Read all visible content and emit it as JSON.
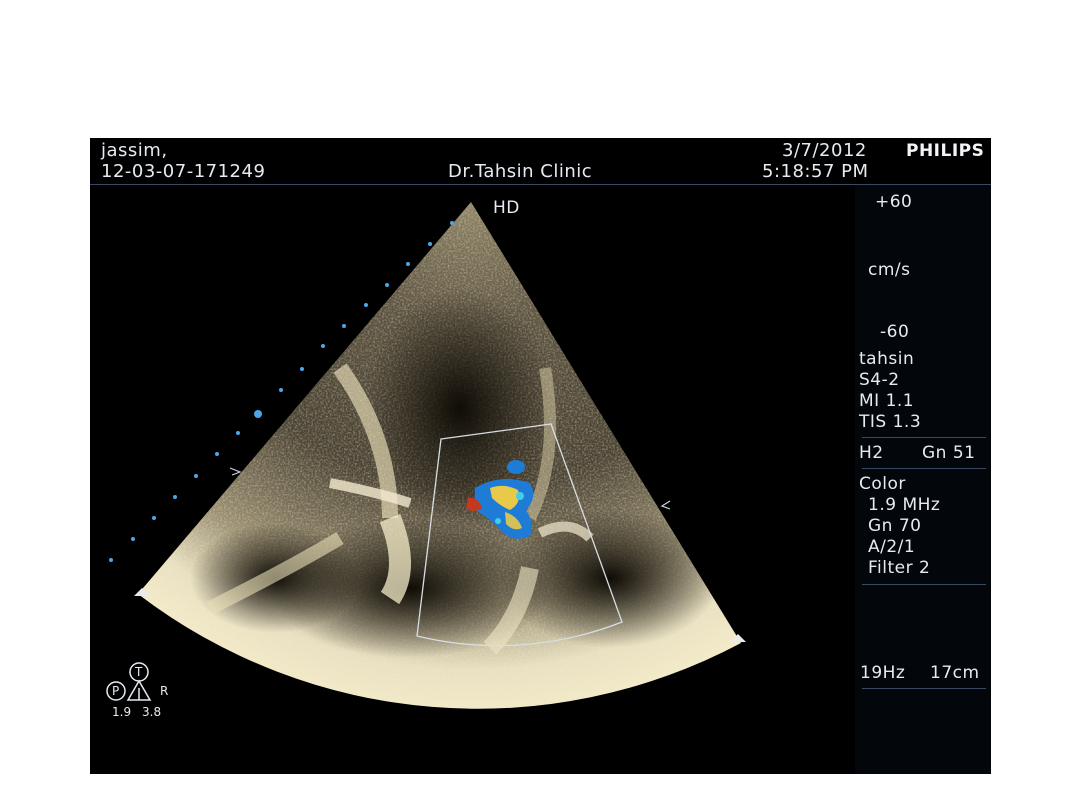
{
  "header": {
    "patient_name": "jassim,",
    "patient_id": "12-03-07-171249",
    "clinic": "Dr.Tahsin Clinic",
    "date": "3/7/2012",
    "time": "5:18:57 PM",
    "brand": "PHILIPS"
  },
  "image": {
    "mode_label": "HD"
  },
  "color_scale": {
    "max_label": "+60",
    "unit_label": "cm/s",
    "min_label": "-60"
  },
  "settings": {
    "preset": "tahsin",
    "probe": "S4-2",
    "mi": "MI 1.1",
    "tis": "TIS 1.3",
    "harmonic": "H2",
    "gain": "Gn 51",
    "color_title": "Color",
    "color_freq": "1.9 MHz",
    "color_gain": "Gn 70",
    "color_params": "A/2/1",
    "color_filter": "Filter 2",
    "frame_rate": "19Hz",
    "depth": "17cm"
  },
  "orientation": {
    "p_label": "P",
    "t_label": "T",
    "r_label": "R",
    "left_value": "1.9",
    "right_value": "3.8"
  },
  "colors": {
    "screen_bg": "#000000",
    "text": "#e6ebf2",
    "tissue": "#f4ecc8",
    "doppler_blue": "#1e7bd6",
    "doppler_red": "#c2391f",
    "marker_dots": "#4aa8e8"
  }
}
